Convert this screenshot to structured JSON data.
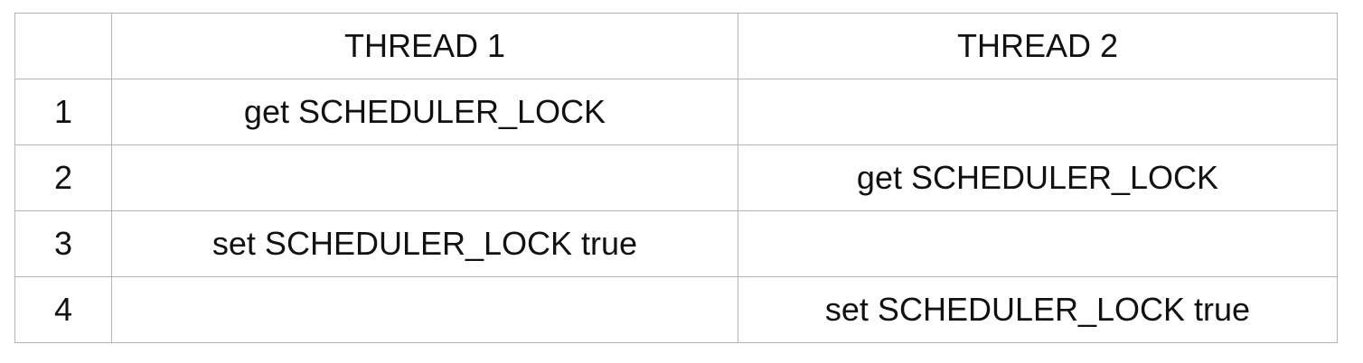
{
  "table": {
    "headers": [
      "",
      "THREAD 1",
      "THREAD 2"
    ],
    "rows": [
      [
        "1",
        "get SCHEDULER_LOCK",
        ""
      ],
      [
        "2",
        "",
        "get SCHEDULER_LOCK"
      ],
      [
        "3",
        "set SCHEDULER_LOCK true",
        ""
      ],
      [
        "4",
        "",
        "set SCHEDULER_LOCK true"
      ]
    ]
  }
}
